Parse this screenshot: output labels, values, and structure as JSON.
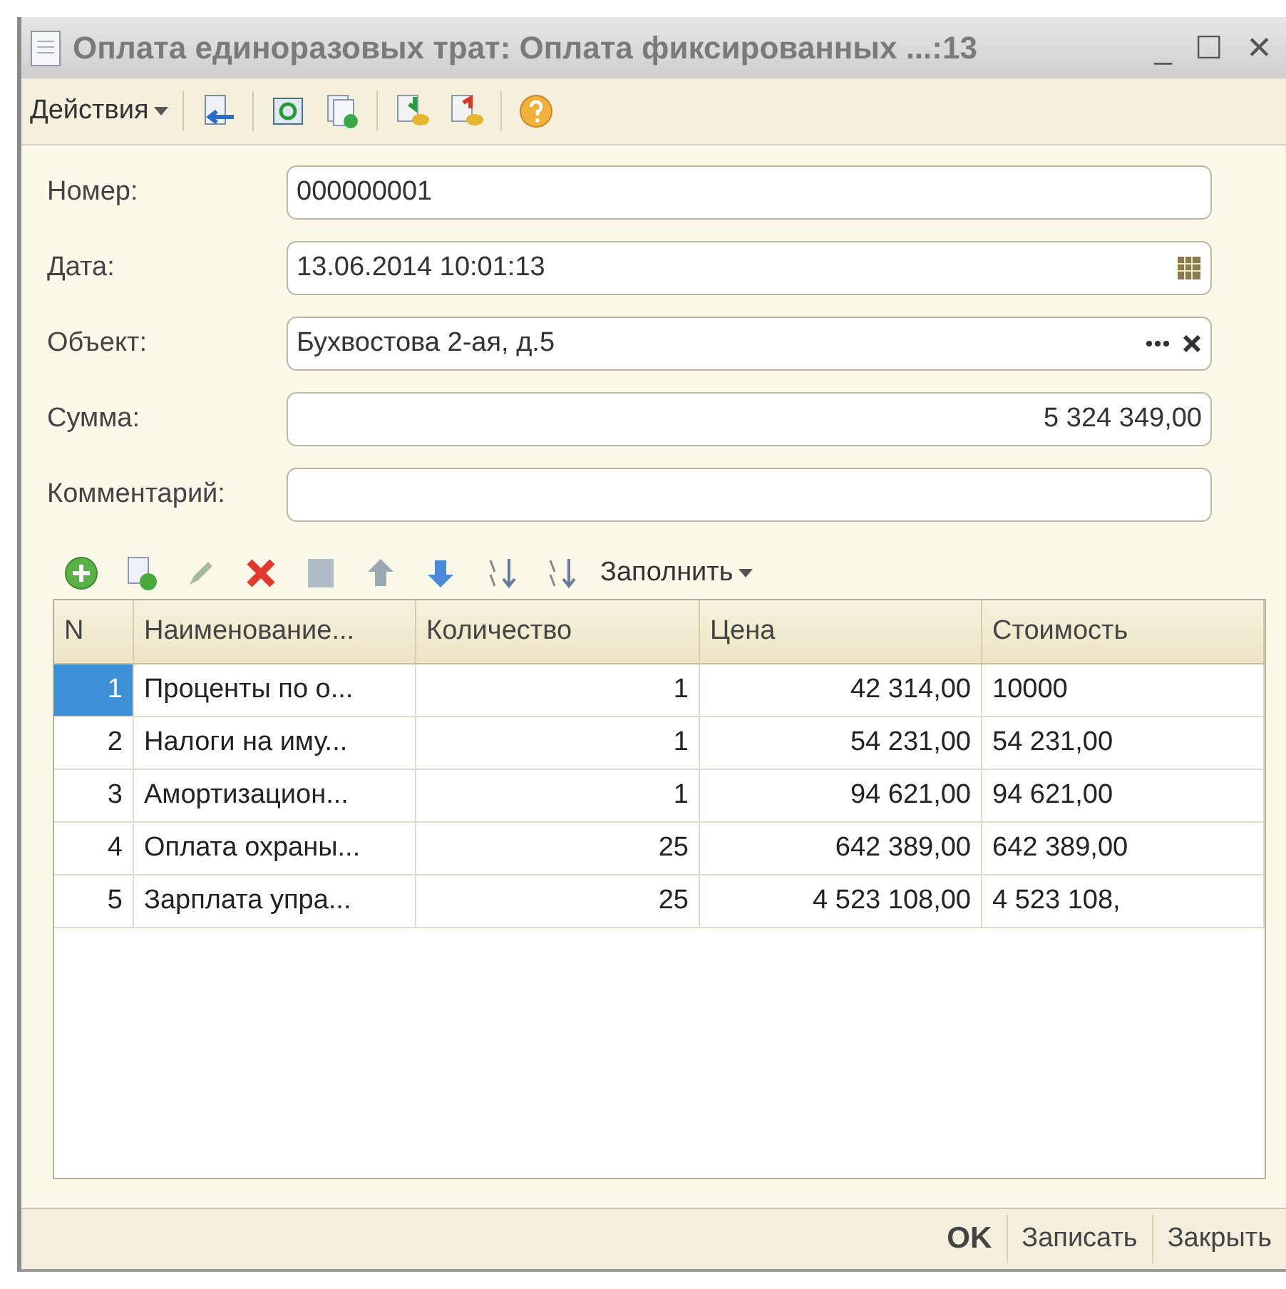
{
  "window": {
    "title": "Оплата единоразовых трат: Оплата фиксированных ...:13",
    "controls": [
      "_",
      "☐",
      "✕"
    ]
  },
  "toolbar": {
    "menu": "Действия"
  },
  "fields": [
    {
      "label": "Номер:",
      "value": "000000001",
      "kind": "text"
    },
    {
      "label": "Дата:",
      "value": "13.06.2014 10:01:13",
      "kind": "date"
    },
    {
      "label": "Объект:",
      "value": "Бухвостова 2-ая, д.5",
      "kind": "select"
    },
    {
      "label": "Сумма:",
      "value": "5 324 349,00",
      "kind": "number"
    },
    {
      "label": "Комментарий:",
      "kind": "text"
    }
  ],
  "table_toolbar": {
    "fill_menu": "Заполнить"
  },
  "table": {
    "columns": [
      "N",
      "Наименование...",
      "Количество",
      "Цена",
      "Стоимость"
    ],
    "rows": [
      {
        "selected": true,
        "cells": [
          "1",
          "Проценты по о...",
          "1",
          "42 314,00",
          "10000"
        ]
      },
      {
        "selected": false,
        "cells": [
          "2",
          "Налоги на иму...",
          "1",
          "54 231,00",
          "54 231,00"
        ]
      },
      {
        "selected": false,
        "cells": [
          "3",
          "Амортизацион...",
          "1",
          "94 621,00",
          "94 621,00"
        ]
      },
      {
        "selected": false,
        "cells": [
          "4",
          "Оплата охраны...",
          "25",
          "642 389,00",
          "642 389,00"
        ]
      },
      {
        "selected": false,
        "cells": [
          "5",
          "Зарплата упра...",
          "25",
          "4 523 108,00",
          "4 523 108,"
        ]
      }
    ]
  },
  "buttons": [
    "OK",
    "Записать",
    "Закрыть"
  ]
}
